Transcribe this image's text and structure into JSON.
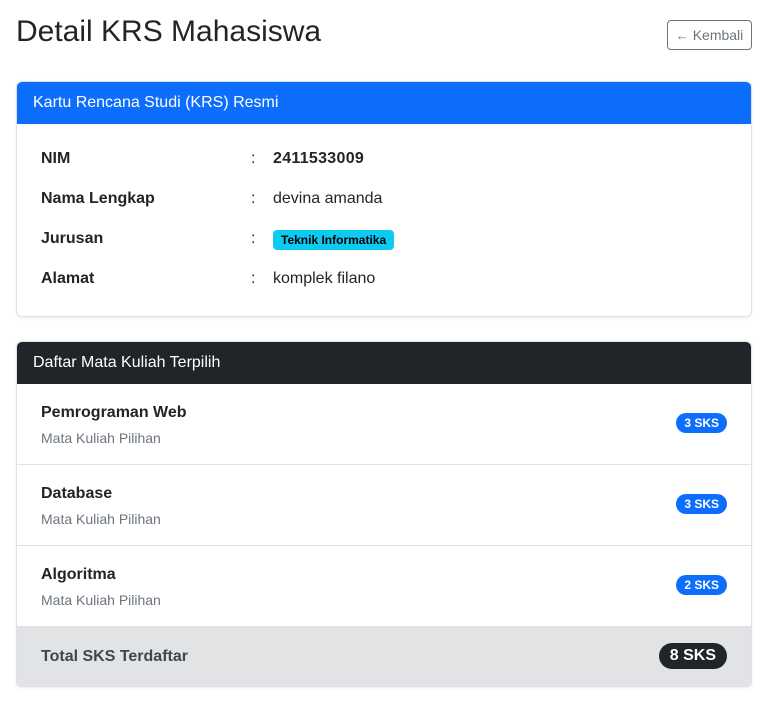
{
  "page": {
    "title": "Detail KRS Mahasiswa",
    "back_label": "Kembali",
    "back_icon": "arrow-left-icon"
  },
  "krs_card": {
    "header": "Kartu Rencana Studi (KRS) Resmi",
    "colon": ":",
    "rows": [
      {
        "label": "NIM",
        "value": "2411533009"
      },
      {
        "label": "Nama Lengkap",
        "value": "devina amanda"
      },
      {
        "label": "Jurusan",
        "value": "Teknik Informatika"
      },
      {
        "label": "Alamat",
        "value": "komplek filano"
      }
    ]
  },
  "courses_card": {
    "header": "Daftar Mata Kuliah Terpilih",
    "items": [
      {
        "name": "Pemrograman Web",
        "type": "Mata Kuliah Pilihan",
        "sks": "3 SKS"
      },
      {
        "name": "Database",
        "type": "Mata Kuliah Pilihan",
        "sks": "3 SKS"
      },
      {
        "name": "Algoritma",
        "type": "Mata Kuliah Pilihan",
        "sks": "2 SKS"
      }
    ],
    "total_label": "Total SKS Terdaftar",
    "total_value": "8 SKS"
  },
  "colors": {
    "primary": "#0d6efd",
    "dark": "#212529",
    "info": "#0dcaf0",
    "secondary": "#6c757d",
    "total_bg": "#e2e3e5"
  }
}
